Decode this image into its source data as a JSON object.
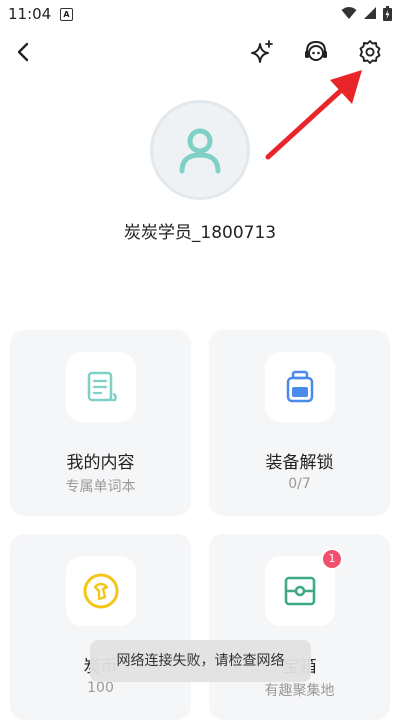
{
  "status_bar": {
    "time": "11:04",
    "app_badge": "A"
  },
  "profile": {
    "username": "炭炭学员_1800713"
  },
  "cards": [
    {
      "title": "我的内容",
      "subtitle": "专属单词本"
    },
    {
      "title": "装备解锁",
      "subtitle": "0/7"
    },
    {
      "title": "炭币",
      "subtitle": "100"
    },
    {
      "title": "宝箱",
      "subtitle": "有趣聚集地",
      "badge": "1"
    }
  ],
  "toast": {
    "message": "网络连接失败，请检查网络"
  },
  "colors": {
    "accent_teal": "#7fd0c6",
    "blue": "#4a8ae8",
    "yellow": "#f5c518",
    "badge_red": "#f0506e",
    "arrow_red": "#e8262a"
  }
}
